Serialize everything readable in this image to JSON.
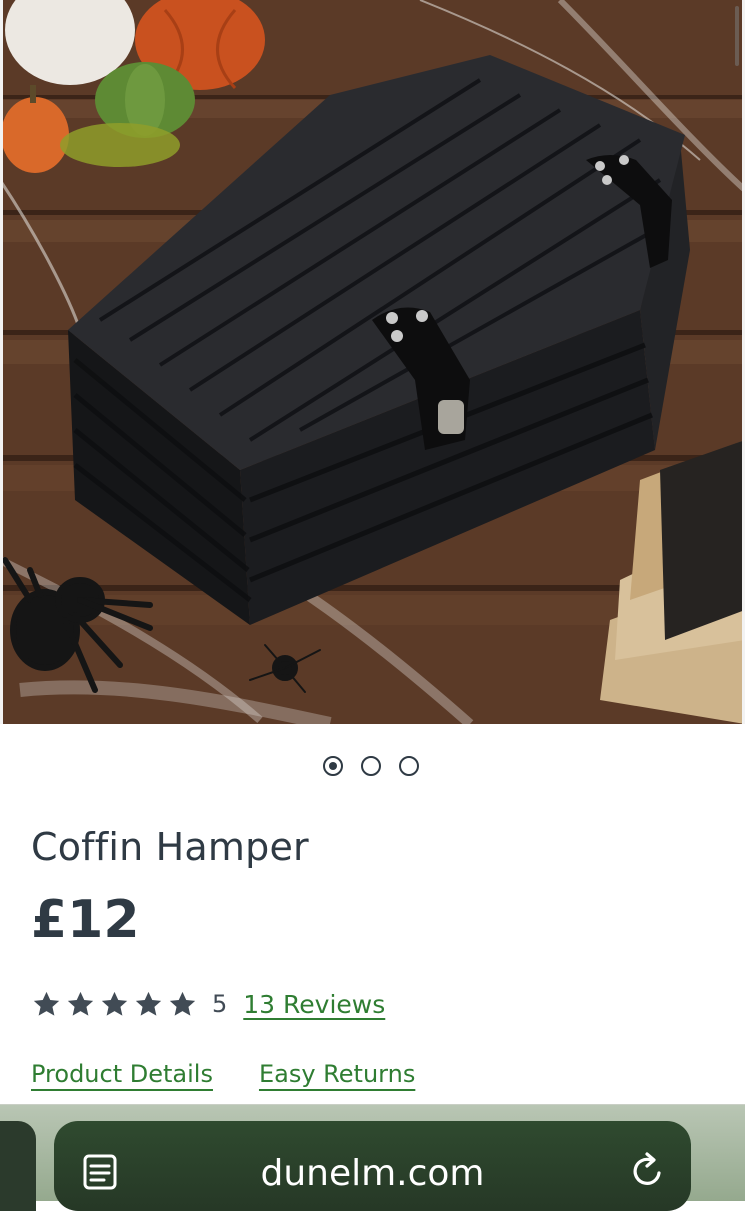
{
  "product": {
    "title": "Coffin Hamper",
    "price": "£12",
    "rating": {
      "stars_filled": 5,
      "stars_total": 5,
      "value": "5",
      "reviews_link": "13 Reviews"
    },
    "links": {
      "details": "Product Details",
      "returns": "Easy Returns"
    }
  },
  "gallery": {
    "image_count": 3,
    "active_index": 1
  },
  "browser": {
    "domain": "dunelm.com",
    "icons": {
      "reader": "reader-mode-icon",
      "reload": "reload-icon"
    }
  },
  "colors": {
    "text_primary": "#2f3a44",
    "link_green": "#2f7d32",
    "star_color": "#414b55",
    "address_bar": "#2f4a2f"
  }
}
